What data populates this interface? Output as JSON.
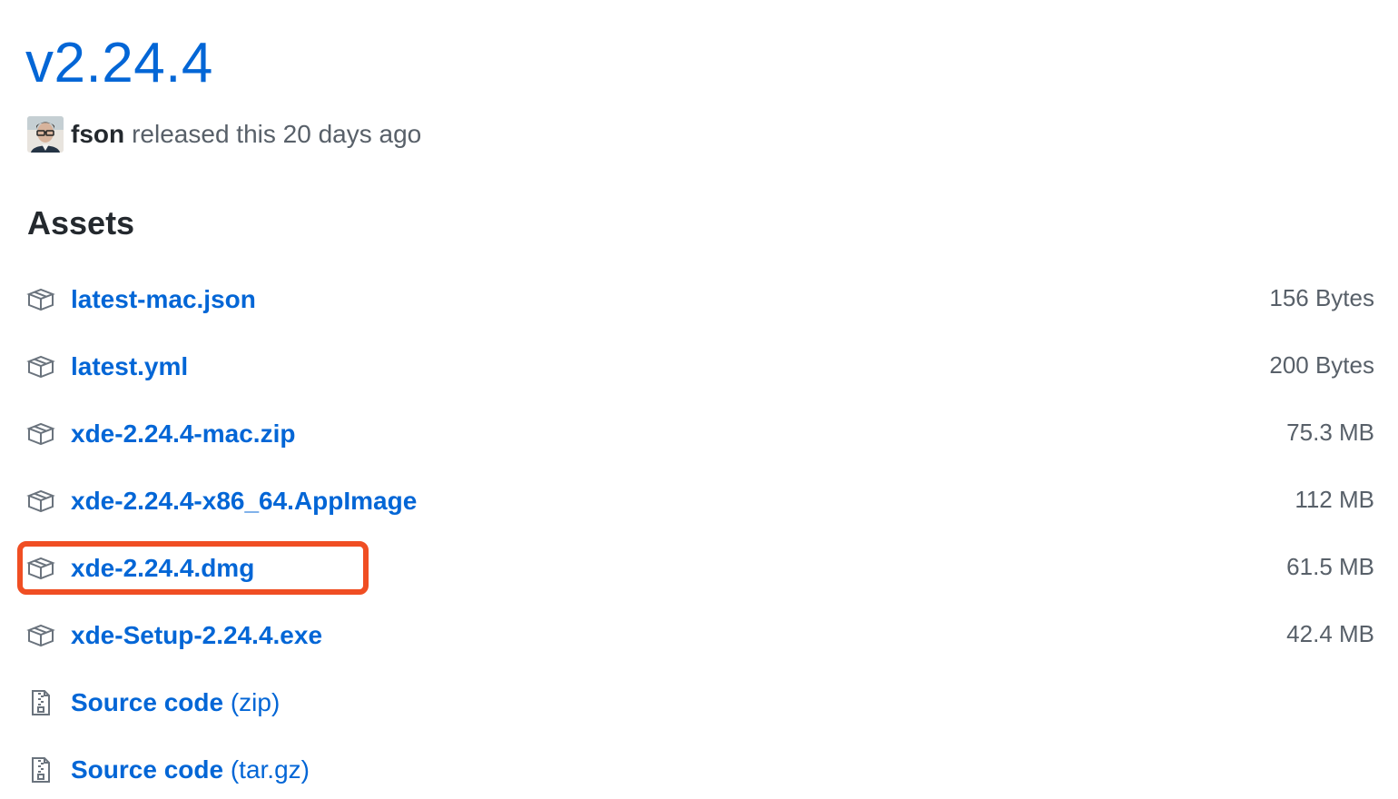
{
  "release": {
    "version": "v2.24.4",
    "author": "fson",
    "released_text": "released this 20 days ago"
  },
  "assets": {
    "heading": "Assets",
    "items": [
      {
        "name": "latest-mac.json",
        "size": "156 Bytes",
        "icon": "package-icon"
      },
      {
        "name": "latest.yml",
        "size": "200 Bytes",
        "icon": "package-icon"
      },
      {
        "name": "xde-2.24.4-mac.zip",
        "size": "75.3 MB",
        "icon": "package-icon"
      },
      {
        "name": "xde-2.24.4-x86_64.AppImage",
        "size": "112 MB",
        "icon": "package-icon"
      },
      {
        "name": "xde-2.24.4.dmg",
        "size": "61.5 MB",
        "icon": "package-icon",
        "highlighted": true
      },
      {
        "name": "xde-Setup-2.24.4.exe",
        "size": "42.4 MB",
        "icon": "package-icon"
      }
    ],
    "source": [
      {
        "label": "Source code",
        "suffix": "(zip)",
        "icon": "file-zip-icon"
      },
      {
        "label": "Source code",
        "suffix": "(tar.gz)",
        "icon": "file-zip-icon"
      }
    ]
  },
  "colors": {
    "link": "#0366d6",
    "muted": "#586069",
    "text": "#24292e",
    "highlight": "#f04e23"
  }
}
